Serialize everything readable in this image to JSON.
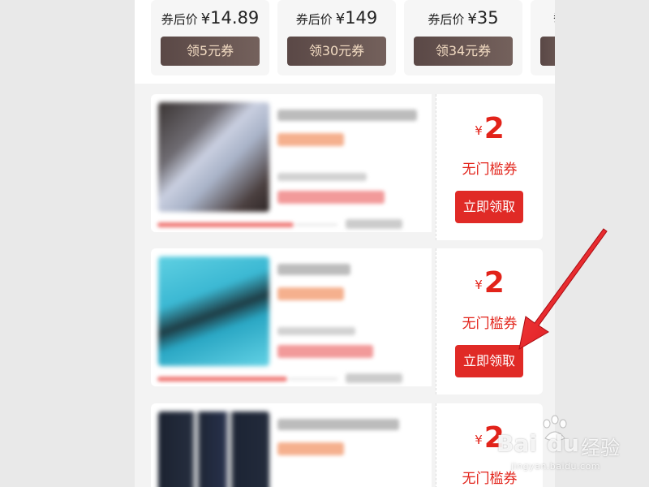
{
  "mini_coupons": [
    {
      "prefix": "券后价",
      "currency": "¥",
      "price": "14.89",
      "button": "领5元券"
    },
    {
      "prefix": "券后价",
      "currency": "¥",
      "price": "149",
      "button": "领30元券"
    },
    {
      "prefix": "券后价",
      "currency": "¥",
      "price": "35",
      "button": "领34元券"
    },
    {
      "prefix": "券",
      "currency": "",
      "price": "",
      "button": ""
    }
  ],
  "coupons": [
    {
      "currency": "¥",
      "amount": "2",
      "type": "无门槛券",
      "button": "立即领取"
    },
    {
      "currency": "¥",
      "amount": "2",
      "type": "无门槛券",
      "button": "立即领取"
    },
    {
      "currency": "¥",
      "amount": "2",
      "type": "无门槛券",
      "button": ""
    }
  ],
  "watermark": {
    "brand": "Bai",
    "brand2": "du",
    "cn": "经验",
    "url": "jingyan.baidu.com"
  },
  "colors": {
    "accent": "#e2231a",
    "button_red": "#e02a26",
    "mini_button": "#5e4b48",
    "mini_button_text": "#f3dcc3",
    "arrow": "#e8141c"
  }
}
